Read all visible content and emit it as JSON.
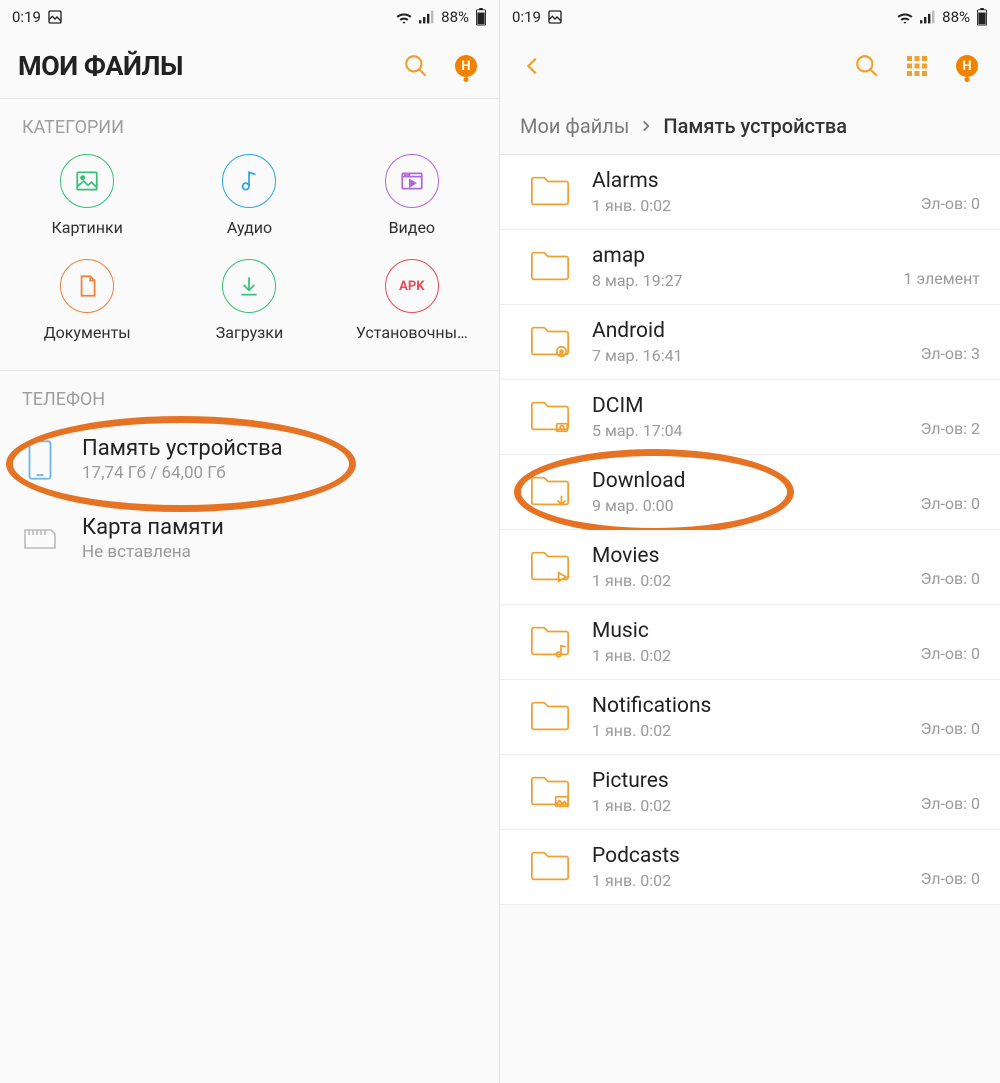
{
  "status": {
    "time": "0:19",
    "battery": "88%"
  },
  "left": {
    "title": "МОИ ФАЙЛЫ",
    "badge": "H",
    "section_categories": "КАТЕГОРИИ",
    "categories": [
      {
        "label": "Картинки",
        "color": "#37c07a",
        "icon": "image"
      },
      {
        "label": "Аудио",
        "color": "#2aa8e0",
        "icon": "audio"
      },
      {
        "label": "Видео",
        "color": "#b168d9",
        "icon": "video"
      },
      {
        "label": "Документы",
        "color": "#f08037",
        "icon": "doc"
      },
      {
        "label": "Загрузки",
        "color": "#37c07a",
        "icon": "download"
      },
      {
        "label": "Установочны…",
        "color": "#e84a5f",
        "icon": "apk",
        "text": "APK"
      }
    ],
    "section_phone": "ТЕЛЕФОН",
    "storage": [
      {
        "title": "Память устройства",
        "sub": "17,74 Гб / 64,00 Гб",
        "icon": "phone",
        "highlight": true
      },
      {
        "title": "Карта памяти",
        "sub": "Не вставлена",
        "icon": "sd"
      }
    ]
  },
  "right": {
    "badge": "H",
    "breadcrumb": {
      "root": "Мои файлы",
      "current": "Память устройства"
    },
    "folders": [
      {
        "name": "Alarms",
        "date": "1 янв. 0:02",
        "meta": "Эл-ов: 0",
        "icon": "folder"
      },
      {
        "name": "amap",
        "date": "8 мар. 19:27",
        "meta": "1 элемент",
        "icon": "folder"
      },
      {
        "name": "Android",
        "date": "7 мар. 16:41",
        "meta": "Эл-ов: 3",
        "icon": "folder-gear"
      },
      {
        "name": "DCIM",
        "date": "5 мар. 17:04",
        "meta": "Эл-ов: 2",
        "icon": "folder-camera"
      },
      {
        "name": "Download",
        "date": "9 мар. 0:00",
        "meta": "Эл-ов: 0",
        "icon": "folder-down",
        "highlight": true
      },
      {
        "name": "Movies",
        "date": "1 янв. 0:02",
        "meta": "Эл-ов: 0",
        "icon": "folder-play"
      },
      {
        "name": "Music",
        "date": "1 янв. 0:02",
        "meta": "Эл-ов: 0",
        "icon": "folder-note"
      },
      {
        "name": "Notifications",
        "date": "1 янв. 0:02",
        "meta": "Эл-ов: 0",
        "icon": "folder"
      },
      {
        "name": "Pictures",
        "date": "1 янв. 0:02",
        "meta": "Эл-ов: 0",
        "icon": "folder-image"
      },
      {
        "name": "Podcasts",
        "date": "1 янв. 0:02",
        "meta": "Эл-ов: 0",
        "icon": "folder"
      }
    ]
  }
}
